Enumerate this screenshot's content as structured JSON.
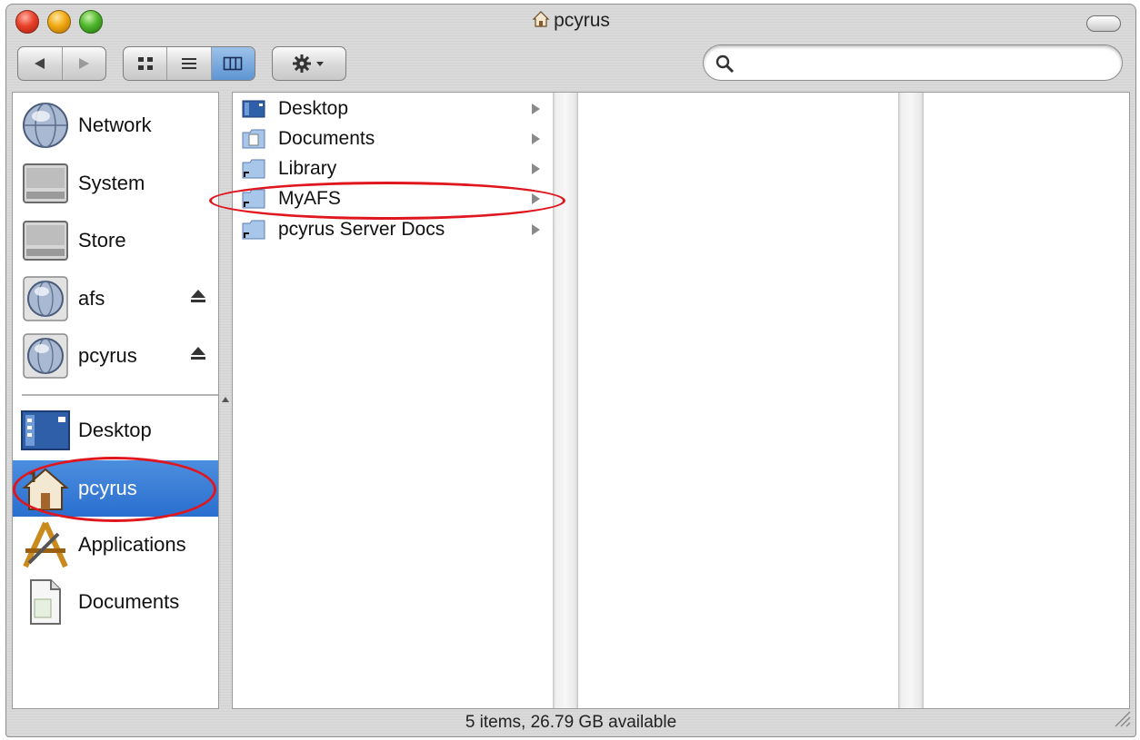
{
  "window": {
    "title": "pcyrus",
    "title_icon": "home-icon",
    "status_text": "5 items, 26.79 GB available"
  },
  "toolbar": {
    "back_icon": "back-arrow-icon",
    "forward_icon": "forward-arrow-icon",
    "view_icons": [
      "icon-view-icon",
      "list-view-icon",
      "column-view-icon"
    ],
    "selected_view": "column",
    "action_icon": "gear-icon",
    "search_icon": "search-icon",
    "search_value": ""
  },
  "sidebar": {
    "devices": [
      {
        "label": "Network",
        "icon": "network-globe-icon",
        "ejectable": false
      },
      {
        "label": "System",
        "icon": "hard-drive-icon",
        "ejectable": false
      },
      {
        "label": "Store",
        "icon": "hard-drive-icon",
        "ejectable": false
      },
      {
        "label": "afs",
        "icon": "network-volume-icon",
        "ejectable": true
      },
      {
        "label": "pcyrus",
        "icon": "network-volume-icon",
        "ejectable": true
      }
    ],
    "places": [
      {
        "label": "Desktop",
        "icon": "desktop-icon",
        "selected": false
      },
      {
        "label": "pcyrus",
        "icon": "home-icon",
        "selected": true
      },
      {
        "label": "Applications",
        "icon": "applications-icon",
        "selected": false
      },
      {
        "label": "Documents",
        "icon": "document-icon",
        "selected": false
      }
    ]
  },
  "columns": [
    {
      "items": [
        {
          "label": "Desktop",
          "icon": "desktop-folder-icon",
          "has_children": true
        },
        {
          "label": "Documents",
          "icon": "documents-folder-icon",
          "has_children": true
        },
        {
          "label": "Library",
          "icon": "alias-folder-icon",
          "has_children": true
        },
        {
          "label": "MyAFS",
          "icon": "alias-folder-icon",
          "has_children": true
        },
        {
          "label": "pcyrus Server Docs",
          "icon": "alias-folder-icon",
          "has_children": true
        }
      ]
    },
    {
      "items": []
    },
    {
      "items": []
    }
  ],
  "colors": {
    "selection": "#2a6fcf",
    "annotation": "#e0161e"
  }
}
